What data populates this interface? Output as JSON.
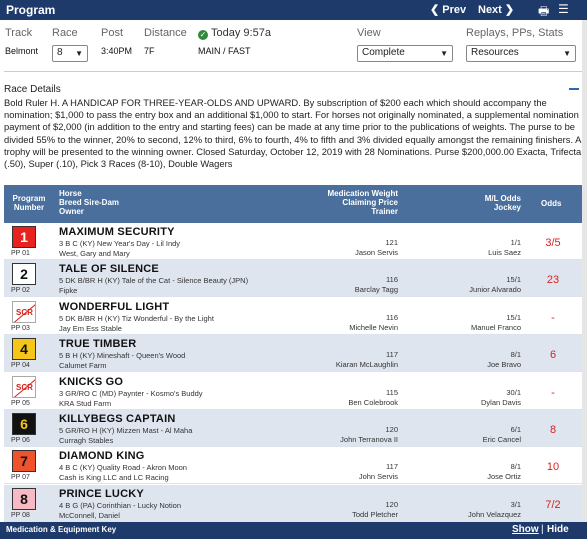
{
  "topbar": {
    "title": "Program",
    "prev": "Prev",
    "next": "Next",
    "print_icon": "printer-icon",
    "menu_icon": "menu-icon"
  },
  "filters": {
    "track_label": "Track",
    "race_label": "Race",
    "post_label": "Post",
    "distance_label": "Distance",
    "today_label": "Today 9:57a",
    "view_label": "View",
    "replays_label": "Replays, PPs, Stats",
    "track_value": "Belmont",
    "race_value": "8",
    "post_value": "3:40PM",
    "distance_value": "7F",
    "surface_value": "MAIN / FAST",
    "view_value": "Complete",
    "resources_value": "Resources"
  },
  "race_details": {
    "title": "Race Details",
    "text": "Bold Ruler H. A HANDICAP FOR THREE-YEAR-OLDS AND UPWARD. By subscription of $200 each which should accompany the nomination; $1,000 to pass the entry box and an additional $1,000 to start. For horses not originally nominated, a supplemental nomination payment of $2,000 (in addition to the entry and starting fees) can be made at any time prior to the publications of weights. The purse to be divided 55% to the winner, 20% to second, 12% to third, 6% to fourth, 4% to fifth and 3% divided equally amongst the remaining finishers. A trophy will be presented to the winning owner. Closed Saturday, October 12, 2019 with 28 Nominations. Purse $200,000.00 Exacta, Trifecta (.50), Super (.10), Pick 3 Races (8-10), Double Wagers"
  },
  "table_headers": {
    "program": "Program",
    "number": "Number",
    "horse": "Horse",
    "breed": "Breed Sire-Dam",
    "owner": "Owner",
    "med": "Medication Weight",
    "claim": "Claiming Price",
    "trainer": "Trainer",
    "ml": "M/L Odds",
    "jockey": "Jockey",
    "odds": "Odds"
  },
  "entries": [
    {
      "num": "1",
      "pp": "PP 01",
      "scratched": false,
      "bg": "#e8231f",
      "fg": "#ffffff",
      "name": "MAXIMUM SECURITY",
      "breed": "3 B C (KY) New Year's Day - Lil Indy",
      "owner": "West, Gary and Mary",
      "weight": "121",
      "trainer": "Jason Servis",
      "ml": "1/1",
      "jockey": "Luis Saez",
      "odds": "3/5"
    },
    {
      "num": "2",
      "pp": "PP 02",
      "scratched": false,
      "bg": "#ffffff",
      "fg": "#111111",
      "name": "TALE OF SILENCE",
      "breed": "5 DK B/BR H (KY) Tale of the Cat - Silence Beauty (JPN)",
      "owner": "Fipke",
      "weight": "116",
      "trainer": "Barclay Tagg",
      "ml": "15/1",
      "jockey": "Junior Alvarado",
      "odds": "23"
    },
    {
      "num": "SCR",
      "pp": "PP 03",
      "scratched": true,
      "bg": "#ffffff",
      "fg": "#d9221b",
      "name": "WONDERFUL LIGHT",
      "breed": "5 DK B/BR H (KY) Tiz Wonderful - By the Light",
      "owner": "Jay Em Ess Stable",
      "weight": "116",
      "trainer": "Michelle Nevin",
      "ml": "15/1",
      "jockey": "Manuel Franco",
      "odds": "-"
    },
    {
      "num": "4",
      "pp": "PP 04",
      "scratched": false,
      "bg": "#f5c518",
      "fg": "#111111",
      "name": "TRUE TIMBER",
      "breed": "5 B H (KY) Mineshaft - Queen's Wood",
      "owner": "Calumet Farm",
      "weight": "117",
      "trainer": "Kiaran McLaughlin",
      "ml": "8/1",
      "jockey": "Joe Bravo",
      "odds": "6"
    },
    {
      "num": "SCR",
      "pp": "PP 05",
      "scratched": true,
      "bg": "#ffffff",
      "fg": "#d9221b",
      "name": "KNICKS GO",
      "breed": "3 GR/RO C (MD) Paynter - Kosmo's Buddy",
      "owner": "KRA Stud Farm",
      "weight": "115",
      "trainer": "Ben Colebrook",
      "ml": "30/1",
      "jockey": "Dylan Davis",
      "odds": "-"
    },
    {
      "num": "6",
      "pp": "PP 06",
      "scratched": false,
      "bg": "#111111",
      "fg": "#f5c518",
      "name": "KILLYBEGS CAPTAIN",
      "breed": "5 GR/RO H (KY) Mizzen Mast - Al Maha",
      "owner": "Curragh Stables",
      "weight": "120",
      "trainer": "John Terranova II",
      "ml": "6/1",
      "jockey": "Eric Cancel",
      "odds": "8"
    },
    {
      "num": "7",
      "pp": "PP 07",
      "scratched": false,
      "bg": "#f0522b",
      "fg": "#111111",
      "name": "DIAMOND KING",
      "breed": "4 B C (KY) Quality Road - Akron Moon",
      "owner": "Cash is King LLC and LC Racing",
      "weight": "117",
      "trainer": "John Servis",
      "ml": "8/1",
      "jockey": "Jose Ortiz",
      "odds": "10"
    },
    {
      "num": "8",
      "pp": "PP 08",
      "scratched": false,
      "bg": "#f7b9c4",
      "fg": "#111111",
      "name": "PRINCE LUCKY",
      "breed": "4 B G (PA) Corinthian - Lucky Notion",
      "owner": "McConnell, Daniel",
      "weight": "120",
      "trainer": "Todd Pletcher",
      "ml": "3/1",
      "jockey": "John Velazquez",
      "odds": "7/2"
    }
  ],
  "footer": {
    "label": "Medication & Equipment Key",
    "show": "Show",
    "sep": "|",
    "hide": "Hide"
  }
}
